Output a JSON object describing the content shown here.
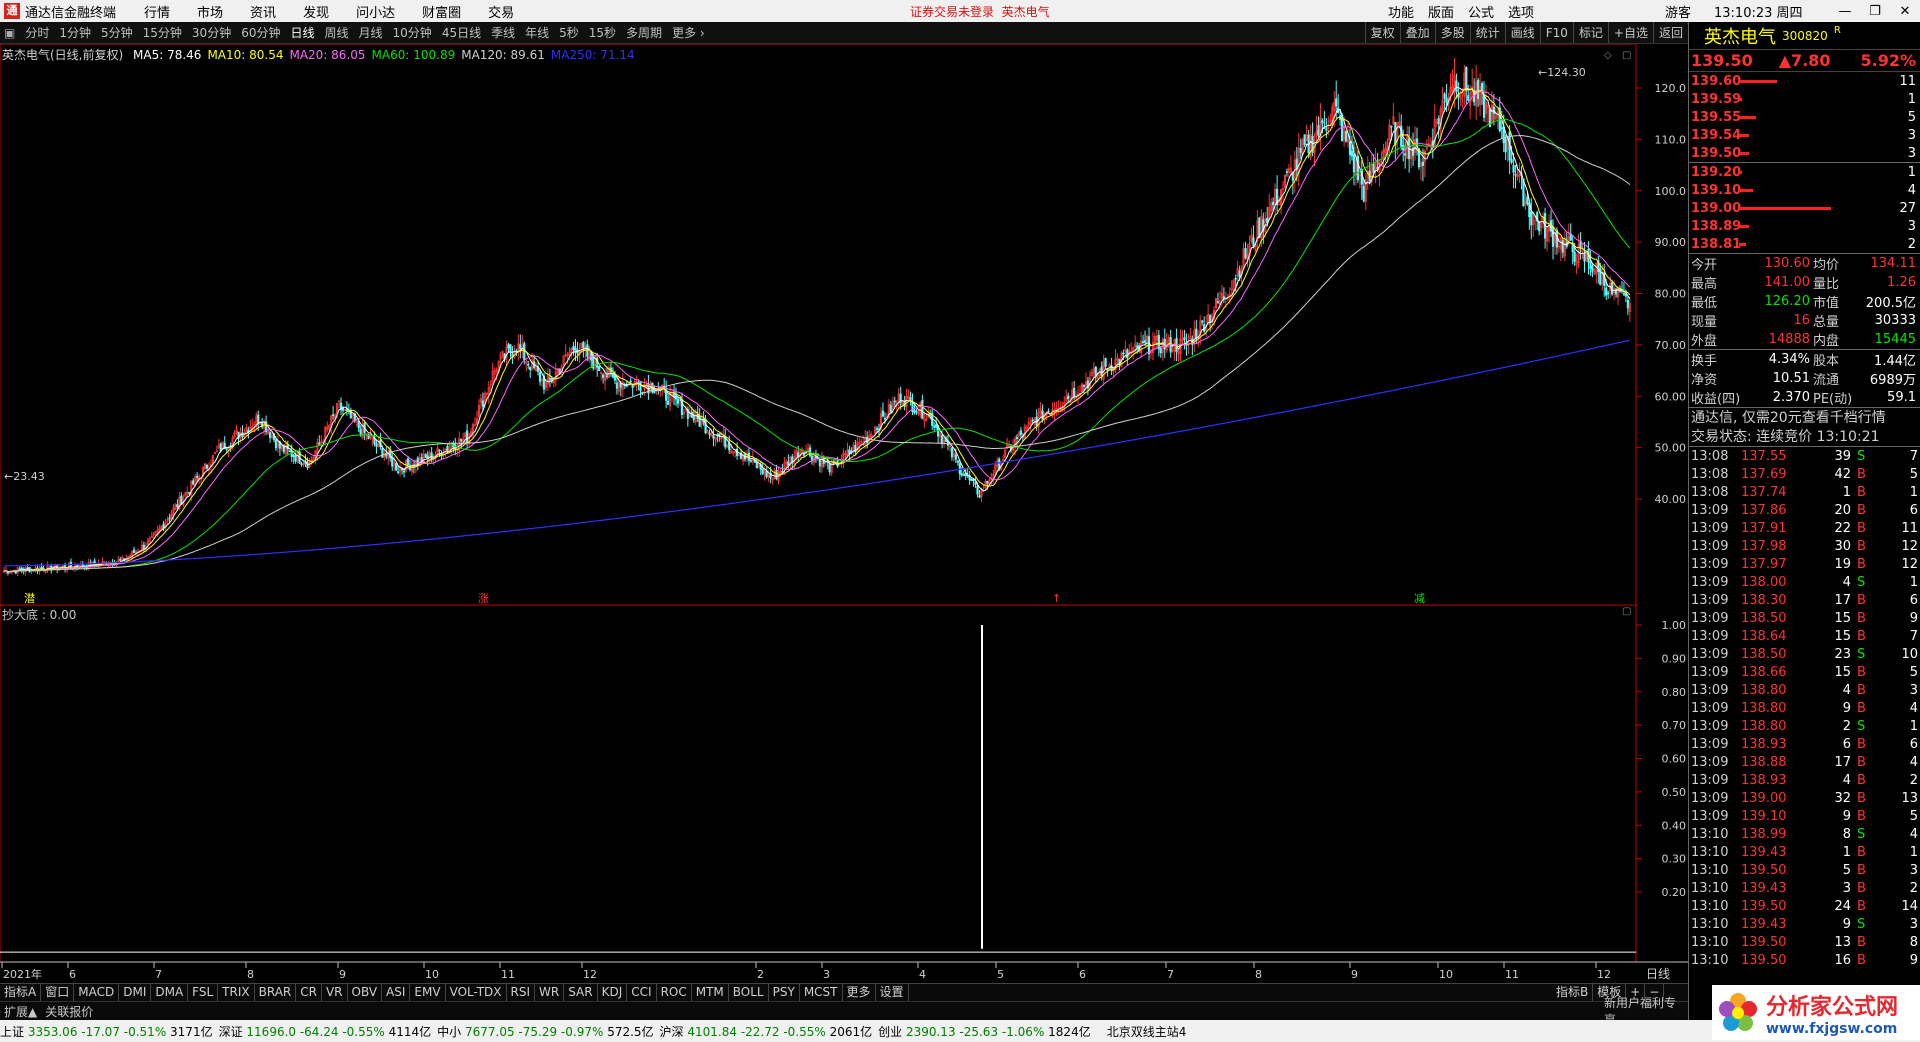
{
  "titlebar": {
    "logo": "通",
    "app_name": "通达信金融终端",
    "menu": [
      "行情",
      "市场",
      "资讯",
      "发现",
      "问小达",
      "财富圈",
      "交易"
    ],
    "warning": "证券交易未登录",
    "warning_stock": "英杰电气",
    "right_menu": [
      "功能",
      "版面",
      "公式",
      "选项"
    ],
    "user": "游客",
    "clock": "13:10:23 周四"
  },
  "periods": [
    "分时",
    "1分钟",
    "5分钟",
    "15分钟",
    "30分钟",
    "60分钟",
    "日线",
    "周线",
    "月线",
    "10分钟",
    "45日线",
    "季线",
    "年线",
    "5秒",
    "15秒",
    "多周期",
    "更多 ›"
  ],
  "active_period": "日线",
  "chart_tools": [
    "复权",
    "叠加",
    "多股",
    "统计",
    "画线",
    "F10",
    "标记",
    "+自选",
    "返回"
  ],
  "chart_info": {
    "name": "英杰电气(日线,前复权)",
    "ma": [
      {
        "label": "MA5: 78.46",
        "color": "#ffffff"
      },
      {
        "label": "MA10: 80.54",
        "color": "#ffff00"
      },
      {
        "label": "MA20: 86.05",
        "color": "#ff66ff"
      },
      {
        "label": "MA60: 100.89",
        "color": "#00e600"
      },
      {
        "label": "MA120: 89.61",
        "color": "#d0d0d0"
      },
      {
        "label": "MA250: 71.14",
        "color": "#3030ff"
      }
    ]
  },
  "sub_info": "抄大底 : 0.00",
  "price_axis": [
    "120.0",
    "110.0",
    "100.0",
    "90.00",
    "80.00",
    "70.00",
    "60.00",
    "50.00",
    "40.00"
  ],
  "sub_axis": [
    "1.00",
    "0.90",
    "0.80",
    "0.70",
    "0.60",
    "0.50",
    "0.40",
    "0.30",
    "0.20"
  ],
  "time_axis": [
    "2021年",
    "6",
    "7",
    "8",
    "9",
    "10",
    "11",
    "12",
    "2",
    "3",
    "4",
    "5",
    "6",
    "7",
    "8",
    "9",
    "10",
    "11",
    "12"
  ],
  "time_axis_label": "日线",
  "high_label": "124.30",
  "low_label": "23.43",
  "markers": [
    {
      "text": "潜",
      "color": "#ffff00"
    },
    {
      "text": "涨",
      "color": "#ff3232"
    },
    {
      "text": "↑",
      "color": "#ff3232"
    },
    {
      "text": "减",
      "color": "#00e600"
    }
  ],
  "indicator_tabs": [
    "指标A",
    "窗口",
    "MACD",
    "DMI",
    "DMA",
    "FSL",
    "TRIX",
    "BRAR",
    "CR",
    "VR",
    "OBV",
    "ASI",
    "EMV",
    "VOL-TDX",
    "RSI",
    "WR",
    "SAR",
    "KDJ",
    "CCI",
    "ROC",
    "MTM",
    "BOLL",
    "PSY",
    "MCST",
    "更多",
    "设置"
  ],
  "tab_right": [
    "指标B",
    "模板",
    "+",
    "−"
  ],
  "ext": [
    "扩展▲",
    "关联报价"
  ],
  "ext_promo": "新用户福利专享",
  "status": [
    {
      "name": "上证",
      "price": "3353.06",
      "chg": "-17.07",
      "pct": "-0.51%",
      "amt": "3171亿"
    },
    {
      "name": "深证",
      "price": "11696.0",
      "chg": "-64.24",
      "pct": "-0.55%",
      "amt": "4114亿"
    },
    {
      "name": "中小",
      "price": "7677.05",
      "chg": "-75.29",
      "pct": "-0.97%",
      "amt": "572.5亿"
    },
    {
      "name": "沪深",
      "price": "4101.84",
      "chg": "-22.72",
      "pct": "-0.55%",
      "amt": "2061亿"
    },
    {
      "name": "创业",
      "price": "2390.13",
      "chg": "-25.63",
      "pct": "-1.06%",
      "amt": "1824亿"
    }
  ],
  "status_station": "北京双线主站4",
  "stock": {
    "name": "英杰电气",
    "code": "300820",
    "r": "R",
    "price": "139.50",
    "chg": "▲7.80",
    "pct": "5.92%"
  },
  "ask": [
    {
      "p": "139.60",
      "v": "11",
      "w": 76
    },
    {
      "p": "139.59",
      "v": "1",
      "w": 6
    },
    {
      "p": "139.55",
      "v": "5",
      "w": 34
    },
    {
      "p": "139.54",
      "v": "3",
      "w": 20
    },
    {
      "p": "139.50",
      "v": "3",
      "w": 20
    }
  ],
  "bid": [
    {
      "p": "139.20",
      "v": "1",
      "w": 6
    },
    {
      "p": "139.10",
      "v": "4",
      "w": 27
    },
    {
      "p": "139.00",
      "v": "27",
      "w": 184
    },
    {
      "p": "138.89",
      "v": "3",
      "w": 20
    },
    {
      "p": "138.81",
      "v": "2",
      "w": 13
    }
  ],
  "stats": [
    {
      "k1": "今开",
      "v1": "130.60",
      "c1": "red",
      "k2": "均价",
      "v2": "134.11",
      "c2": "red"
    },
    {
      "k1": "最高",
      "v1": "141.00",
      "c1": "red",
      "k2": "量比",
      "v2": "1.26",
      "c2": "red"
    },
    {
      "k1": "最低",
      "v1": "126.20",
      "c1": "green",
      "k2": "市值",
      "v2": "200.5亿",
      "c2": "wht"
    },
    {
      "k1": "现量",
      "v1": "16",
      "c1": "red",
      "k2": "总量",
      "v2": "30333",
      "c2": "wht"
    },
    {
      "k1": "外盘",
      "v1": "14888",
      "c1": "red",
      "k2": "内盘",
      "v2": "15445",
      "c2": "green"
    }
  ],
  "stats2": [
    {
      "k1": "换手",
      "v1": "4.34%",
      "c1": "wht",
      "k2": "股本",
      "v2": "1.44亿",
      "c2": "wht"
    },
    {
      "k1": "净资",
      "v1": "10.51",
      "c1": "wht",
      "k2": "流通",
      "v2": "6989万",
      "c2": "wht"
    },
    {
      "k1": "收益(四)",
      "v1": "2.370",
      "c1": "wht",
      "k2": "PE(动)",
      "v2": "59.1",
      "c2": "wht"
    }
  ],
  "notice": "通达信, 仅需20元查看千档行情",
  "trade_state": "交易状态: 连续竞价 13:10:21",
  "ticks": [
    {
      "t": "13:08",
      "p": "137.55",
      "q": "39",
      "bs": "S",
      "n": "7"
    },
    {
      "t": "13:08",
      "p": "137.69",
      "q": "42",
      "bs": "B",
      "n": "5"
    },
    {
      "t": "13:08",
      "p": "137.74",
      "q": "1",
      "bs": "B",
      "n": "1"
    },
    {
      "t": "13:09",
      "p": "137.86",
      "q": "20",
      "bs": "B",
      "n": "6"
    },
    {
      "t": "13:09",
      "p": "137.91",
      "q": "22",
      "bs": "B",
      "n": "11"
    },
    {
      "t": "13:09",
      "p": "137.98",
      "q": "30",
      "bs": "B",
      "n": "12"
    },
    {
      "t": "13:09",
      "p": "137.97",
      "q": "19",
      "bs": "B",
      "n": "12"
    },
    {
      "t": "13:09",
      "p": "138.00",
      "q": "4",
      "bs": "S",
      "n": "1"
    },
    {
      "t": "13:09",
      "p": "138.30",
      "q": "17",
      "bs": "B",
      "n": "6"
    },
    {
      "t": "13:09",
      "p": "138.50",
      "q": "15",
      "bs": "B",
      "n": "9"
    },
    {
      "t": "13:09",
      "p": "138.64",
      "q": "15",
      "bs": "B",
      "n": "7"
    },
    {
      "t": "13:09",
      "p": "138.50",
      "q": "23",
      "bs": "S",
      "n": "10"
    },
    {
      "t": "13:09",
      "p": "138.66",
      "q": "15",
      "bs": "B",
      "n": "5"
    },
    {
      "t": "13:09",
      "p": "138.80",
      "q": "4",
      "bs": "B",
      "n": "3"
    },
    {
      "t": "13:09",
      "p": "138.80",
      "q": "9",
      "bs": "B",
      "n": "4"
    },
    {
      "t": "13:09",
      "p": "138.80",
      "q": "2",
      "bs": "S",
      "n": "1"
    },
    {
      "t": "13:09",
      "p": "138.93",
      "q": "6",
      "bs": "B",
      "n": "6"
    },
    {
      "t": "13:09",
      "p": "138.88",
      "q": "17",
      "bs": "B",
      "n": "4"
    },
    {
      "t": "13:09",
      "p": "138.93",
      "q": "4",
      "bs": "B",
      "n": "2"
    },
    {
      "t": "13:09",
      "p": "139.00",
      "q": "32",
      "bs": "B",
      "n": "13"
    },
    {
      "t": "13:09",
      "p": "139.10",
      "q": "9",
      "bs": "B",
      "n": "5"
    },
    {
      "t": "13:10",
      "p": "138.99",
      "q": "8",
      "bs": "S",
      "n": "4"
    },
    {
      "t": "13:10",
      "p": "139.43",
      "q": "1",
      "bs": "B",
      "n": "1"
    },
    {
      "t": "13:10",
      "p": "139.50",
      "q": "5",
      "bs": "B",
      "n": "3"
    },
    {
      "t": "13:10",
      "p": "139.43",
      "q": "3",
      "bs": "B",
      "n": "2"
    },
    {
      "t": "13:10",
      "p": "139.50",
      "q": "24",
      "bs": "B",
      "n": "14"
    },
    {
      "t": "13:10",
      "p": "139.43",
      "q": "9",
      "bs": "S",
      "n": "3"
    },
    {
      "t": "13:10",
      "p": "139.50",
      "q": "13",
      "bs": "B",
      "n": "8"
    },
    {
      "t": "13:10",
      "p": "139.50",
      "q": "16",
      "bs": "B",
      "n": "9"
    }
  ],
  "brand": {
    "t1": "分析家公式网",
    "t2": "www.fxjgsw.com"
  },
  "colors": {
    "up": "#ff3232",
    "down": "#54ffff",
    "bg": "#000000",
    "ma5": "#ffffff",
    "ma10": "#ffff00",
    "ma20": "#ff66ff",
    "ma60": "#00e600",
    "ma250": "#3030ff",
    "border": "#c00000"
  }
}
